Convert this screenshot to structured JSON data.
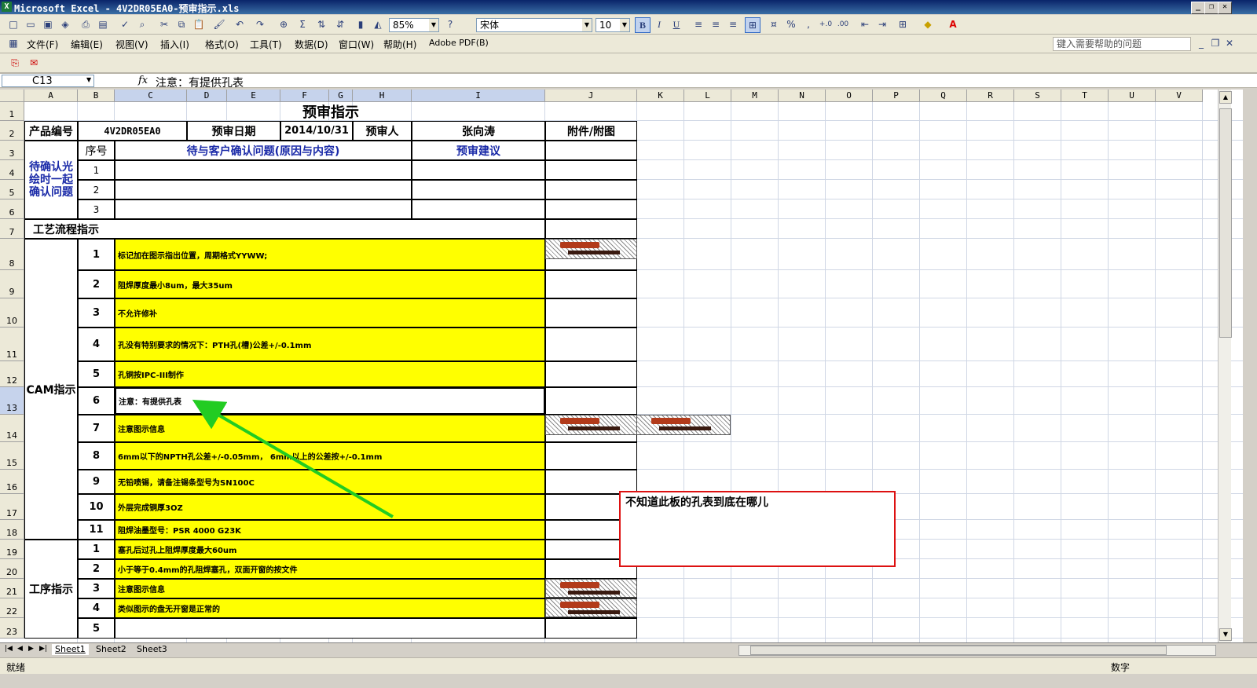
{
  "window": {
    "title": "Microsoft Excel - 4V2DR05EA0-预审指示.xls",
    "controls": {
      "minimize": "_",
      "restore": "❐",
      "close": "✕"
    }
  },
  "toolbar": {
    "zoom": "85%",
    "font_name": "宋体",
    "font_size": "10",
    "bold": "B",
    "italic": "I",
    "underline": "U",
    "percent": "%",
    "comma": ","
  },
  "menu": {
    "items": [
      "文件(F)",
      "编辑(E)",
      "视图(V)",
      "插入(I)",
      "格式(O)",
      "工具(T)",
      "数据(D)",
      "窗口(W)",
      "帮助(H)",
      "Adobe PDF(B)"
    ],
    "help_placeholder": "键入需要帮助的问题"
  },
  "formula_bar": {
    "name_box": "C13",
    "fx": "fx",
    "content": "注意：有提供孔表"
  },
  "columns": [
    "A",
    "B",
    "C",
    "D",
    "E",
    "F",
    "G",
    "H",
    "I",
    "J",
    "K",
    "L",
    "M",
    "N",
    "O",
    "P",
    "Q",
    "R",
    "S",
    "T",
    "U",
    "V"
  ],
  "rows": [
    "1",
    "2",
    "3",
    "4",
    "5",
    "6",
    "7",
    "8",
    "9",
    "10",
    "11",
    "12",
    "13",
    "14",
    "15",
    "16",
    "17",
    "18",
    "19",
    "20",
    "21",
    "22",
    "23"
  ],
  "sheet": {
    "title": "预审指示",
    "product_no_label": "产品编号",
    "product_no": "4V2DR05EA0",
    "review_date_label": "预审日期",
    "review_date": "2014/10/31",
    "reviewer_label": "预审人",
    "reviewer": "张向涛",
    "attachment_label": "附件/附图",
    "pending_label": "待确认光绘时一起确认问题",
    "seq_label": "序号",
    "question_header": "待与客户确认问题(原因与内容)",
    "suggestion_header": "预审建议",
    "pending_seq": [
      "1",
      "2",
      "3"
    ],
    "process_label": "工艺流程指示",
    "cam_label": "CAM指示",
    "cam_items": [
      {
        "no": "1",
        "text": "标记加在图示指出位置，周期格式YYWW;"
      },
      {
        "no": "2",
        "text": "阻焊厚度最小8um，最大35um"
      },
      {
        "no": "3",
        "text": "不允许修补"
      },
      {
        "no": "4",
        "text": "孔没有特别要求的情况下：PTH孔(槽)公差+/-0.1mm"
      },
      {
        "no": "5",
        "text": "孔铜按IPC-III制作"
      },
      {
        "no": "6",
        "text": "注意：有提供孔表"
      },
      {
        "no": "7",
        "text": "注意图示信息"
      },
      {
        "no": "8",
        "text": "6mm以下的NPTH孔公差+/-0.05mm， 6mm以上的公差按+/-0.1mm"
      },
      {
        "no": "9",
        "text": "无铅喷锡，请备注锡条型号为SN100C"
      },
      {
        "no": "10",
        "text": "外层完成铜厚3OZ"
      },
      {
        "no": "11",
        "text": "阻焊油墨型号：PSR 4000 G23K"
      }
    ],
    "proc_label": "工序指示",
    "proc_items": [
      {
        "no": "1",
        "text": "塞孔后过孔上阻焊厚度最大60um"
      },
      {
        "no": "2",
        "text": "小于等于0.4mm的孔阻焊塞孔，双面开窗的按文件"
      },
      {
        "no": "3",
        "text": "注意图示信息"
      },
      {
        "no": "4",
        "text": "类似图示的盘无开窗是正常的"
      },
      {
        "no": "5",
        "text": ""
      }
    ]
  },
  "comment": "不知道此板的孔表到底在哪儿",
  "sheet_tabs": [
    "Sheet1",
    "Sheet2",
    "Sheet3"
  ],
  "status": {
    "left": "就绪",
    "right": "数字"
  },
  "colors": {
    "highlight": "#ffff00",
    "arrow": "#22cc22",
    "comment_border": "#dd1111"
  }
}
